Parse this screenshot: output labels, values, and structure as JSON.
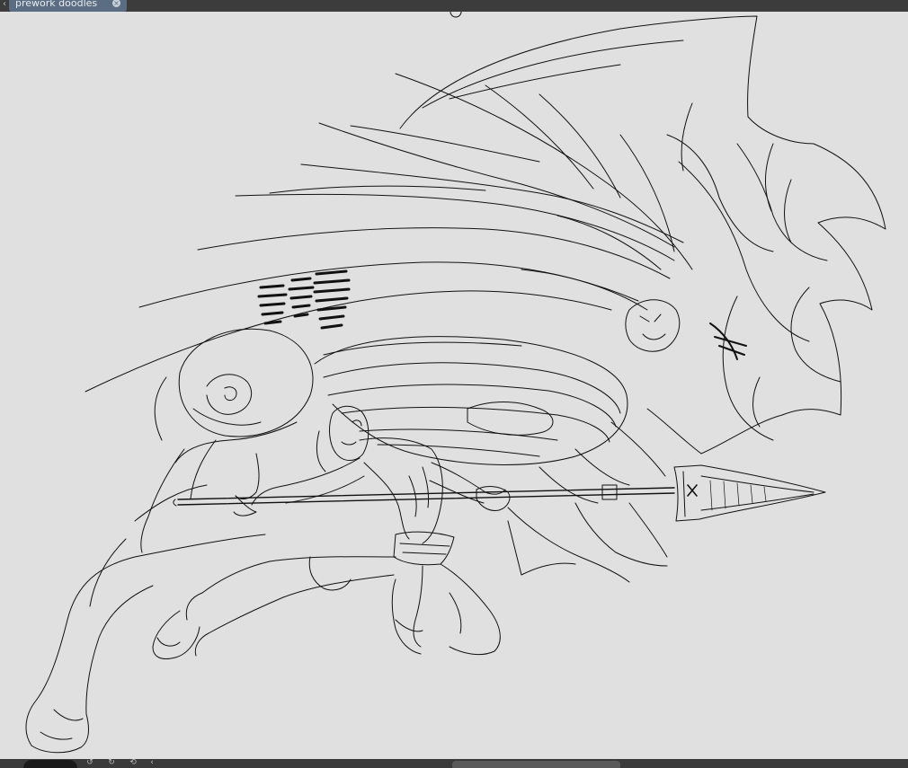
{
  "document_tab": {
    "title": "prework doodles",
    "close_icon": "close-circle-icon",
    "nav_icon": "chevron-left-icon"
  },
  "canvas": {
    "background": "#e0e0e0",
    "stroke_color": "#111111",
    "subject": "line-art-sketch"
  },
  "status_bar": {
    "controls": [
      "rotate-left-icon",
      "rotate-right-icon",
      "reset-rotation-icon",
      "chevron-left-icon"
    ]
  },
  "colors": {
    "titlebar": "#3c3c3c",
    "tab_active": "#5b6d82",
    "statusbar": "#3a3a3a"
  }
}
